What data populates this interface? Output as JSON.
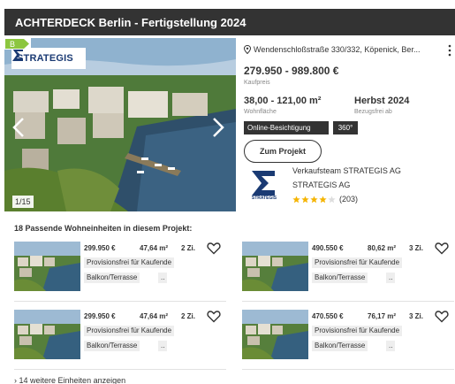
{
  "header": {
    "title": "ACHTERDECK Berlin - Fertigstellung 2024"
  },
  "gallery": {
    "logo_text": "STRATEGIS",
    "counter": "1/15",
    "energy_class": "B",
    "energy_color": "#8cc63f"
  },
  "details": {
    "address": "Wendenschloßstraße 330/332, Köpenick, Ber...",
    "price": "279.950 - 989.800 €",
    "price_label": "Kaufpreis",
    "area": "38,00 - 121,00 m²",
    "area_label": "Wohnfläche",
    "availability": "Herbst 2024",
    "availability_label": "Bezugsfrei ab",
    "tags": [
      "Online-Besichtigung",
      "360°"
    ],
    "project_button": "Zum Projekt"
  },
  "agent": {
    "logo_text": "STRATEGIS",
    "name": "Verkaufsteam STRATEGIS AG",
    "company": "STRATEGIS AG",
    "rating": 4,
    "rating_max": 5,
    "rating_count": "(203)"
  },
  "units_heading": "18 Passende Wohneinheiten in diesem Projekt:",
  "units": [
    {
      "price": "299.950 €",
      "area": "47,64 m²",
      "rooms": "2 Zi.",
      "chips": [
        "Provisionsfrei für Kaufende",
        "Balkon/Terrasse",
        ".."
      ]
    },
    {
      "price": "490.550 €",
      "area": "80,62 m²",
      "rooms": "3 Zi.",
      "chips": [
        "Provisionsfrei für Kaufende",
        "Balkon/Terrasse",
        ".."
      ]
    },
    {
      "price": "299.950 €",
      "area": "47,64 m²",
      "rooms": "2 Zi.",
      "chips": [
        "Provisionsfrei für Kaufende",
        "Balkon/Terrasse",
        ".."
      ]
    },
    {
      "price": "470.550 €",
      "area": "76,17 m²",
      "rooms": "3 Zi.",
      "chips": [
        "Provisionsfrei für Kaufende",
        "Balkon/Terrasse",
        ".."
      ]
    }
  ],
  "more_units": "14 weitere Einheiten anzeigen",
  "colors": {
    "header_bg": "#333333",
    "brand": "#1a3a73",
    "star": "#f5b400"
  }
}
